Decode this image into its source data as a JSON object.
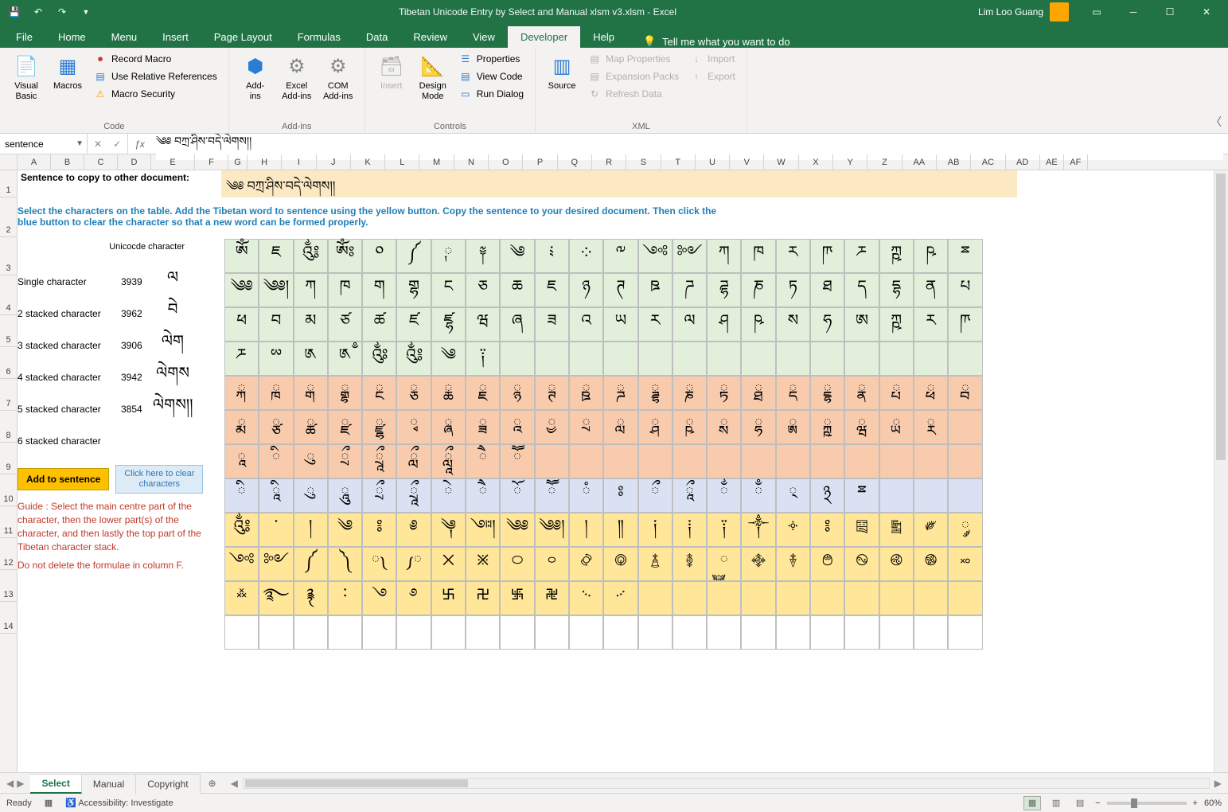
{
  "title": "Tibetan Unicode Entry by Select and Manual xlsm v3.xlsm  -  Excel",
  "user": "Lim Loo Guang",
  "tabs": [
    "File",
    "Home",
    "Menu",
    "Insert",
    "Page Layout",
    "Formulas",
    "Data",
    "Review",
    "View",
    "Developer",
    "Help"
  ],
  "active_tab": "Developer",
  "tell_me": "Tell me what you want to do",
  "ribbon": {
    "code": {
      "visual_basic": "Visual\nBasic",
      "macros": "Macros",
      "record_macro": "Record Macro",
      "use_relative": "Use Relative References",
      "macro_security": "Macro Security",
      "label": "Code"
    },
    "addins": {
      "addins": "Add-\nins",
      "excel_addins": "Excel\nAdd-ins",
      "com_addins": "COM\nAdd-ins",
      "label": "Add-ins"
    },
    "controls": {
      "insert": "Insert",
      "design_mode": "Design\nMode",
      "properties": "Properties",
      "view_code": "View Code",
      "run_dialog": "Run Dialog",
      "label": "Controls"
    },
    "xml": {
      "source": "Source",
      "map_properties": "Map Properties",
      "expansion_packs": "Expansion Packs",
      "refresh_data": "Refresh Data",
      "import": "Import",
      "export": "Export",
      "label": "XML"
    }
  },
  "name_box": "sentence",
  "formula": "༄༅ བཀྲ་ཤིས་བདེ་ལེགས།།",
  "columns": [
    "A",
    "B",
    "C",
    "D",
    "E",
    "F",
    "G",
    "H",
    "I",
    "J",
    "K",
    "L",
    "M",
    "N",
    "O",
    "P",
    "Q",
    "R",
    "S",
    "T",
    "U",
    "V",
    "W",
    "X",
    "Y",
    "Z",
    "AA",
    "AB",
    "AC",
    "AD",
    "AE",
    "AF"
  ],
  "sentence_label": "Sentence to copy to other document:",
  "sentence_value": "༄༅ བཀྲ་ཤིས་བདེ་ལེགས།།",
  "instruction": "Select the characters on the table. Add the Tibetan word to sentence using the yellow button. Copy the sentence to your desired document. Then click the blue button to clear the character so that a new word can be formed properly.",
  "unicode_header": "Unicocde character",
  "left_rows": [
    {
      "label": "Single character",
      "code": "3939",
      "char": "ལ"
    },
    {
      "label": "2 stacked character",
      "code": "3962",
      "char": "བེ"
    },
    {
      "label": "3 stacked character",
      "code": "3906",
      "char": "ལེག"
    },
    {
      "label": "4 stacked character",
      "code": "3942",
      "char": "ལེགས"
    },
    {
      "label": "5 stacked character",
      "code": "3854",
      "char": "ལེགས།།"
    },
    {
      "label": "6 stacked character",
      "code": "",
      "char": ""
    }
  ],
  "btn_add": "Add to sentence",
  "btn_clear": "Click here to clear characters",
  "guide1": "Guide : Select the main centre part of the character, then the lower part(s) of the character, and then lastly the top part of the Tibetan character stack.",
  "guide2": "Do not delete the formulae in column F.",
  "char_rows": [
    {
      "cls": "green",
      "chars": [
        "ༀ",
        "ཇ",
        "༃",
        "ༀཿ",
        "༠",
        "༼",
        "༙",
        "༈",
        "༄",
        "༴",
        "༶",
        "༸",
        "༺",
        "༻",
        "ཀ",
        "ཁ",
        "ཪ",
        "ཫ",
        "ཬ",
        "ཀྵ",
        "ཥ",
        "ྈ"
      ]
    },
    {
      "cls": "green",
      "chars": [
        "༄༅",
        "༄༅།",
        "ཀ",
        "ཁ",
        "ག",
        "གྷ",
        "ང",
        "ཅ",
        "ཆ",
        "ཇ",
        "ཉ",
        "ཊ",
        "ཋ",
        "ཌ",
        "ཌྷ",
        "ཎ",
        "ཏ",
        "ཐ",
        "ད",
        "དྷ",
        "ན",
        "པ"
      ]
    },
    {
      "cls": "green",
      "chars": [
        "ཕ",
        "བ",
        "མ",
        "ཙ",
        "ཚ",
        "ཛ",
        "ཛྷ",
        "ཝ",
        "ཞ",
        "ཟ",
        "འ",
        "ཡ",
        "ར",
        "ལ",
        "ཤ",
        "ཥ",
        "ས",
        "ཧ",
        "ཨ",
        "ཀྵ",
        "ཪ",
        "ཫ"
      ]
    },
    {
      "cls": "green",
      "chars": [
        "ཬ",
        "ྌ",
        "༁",
        "༁ྃ",
        "༂",
        "༃",
        "༄",
        "༑",
        "",
        "",
        "",
        "",
        "",
        "",
        "",
        "",
        "",
        "",
        "",
        "",
        "",
        ""
      ]
    },
    {
      "cls": "orange",
      "chars": [
        "ྐ",
        "ྑ",
        "ྒ",
        "ྒྷ",
        "ྔ",
        "ྕ",
        "ྖ",
        "ྗ",
        "ྙ",
        "ྚ",
        "ྛ",
        "ྜ",
        "ྜྷ",
        "ྞ",
        "ྟ",
        "ྠ",
        "ྡ",
        "ྡྷ",
        "ྣ",
        "ྤ",
        "ྥ",
        "ྦ"
      ]
    },
    {
      "cls": "orange",
      "chars": [
        "ྨ",
        "ྩ",
        "ྪ",
        "ྫ",
        "ྫྷ",
        "ྭ",
        "ྮ",
        "ྯ",
        "ྰ",
        "ྱ",
        "ྲ",
        "ླ",
        "ྴ",
        "ྵ",
        "ྶ",
        "ྷ",
        "ྸ",
        "ྐྵ",
        "ྺ",
        "ྻ",
        "ྼ",
        ""
      ]
    },
    {
      "cls": "orange",
      "chars": [
        "ཱ",
        "ི",
        "ུ",
        "ྲྀ",
        "ཷ",
        "ླྀ",
        "ཹ",
        "ཻ",
        "ཽ",
        "",
        "",
        "",
        "",
        "",
        "",
        "",
        "",
        "",
        "",
        "",
        "",
        ""
      ]
    },
    {
      "cls": "blue",
      "chars": [
        "ི",
        "ཱི",
        "ུ",
        "ཱུ",
        "ྲྀ",
        "ཷ",
        "ེ",
        "ཻ",
        "ོ",
        "ཽ",
        "ཾ",
        "ཿ",
        "ྀ",
        "ཱྀ",
        "ྂ",
        "ྃ",
        "྄",
        "྅",
        "ྈ",
        "",
        "",
        ""
      ]
    },
    {
      "cls": "yellow",
      "chars": [
        "༃",
        "་",
        "།",
        "༄",
        "༔",
        "༅",
        "༆",
        "༇།",
        "༄༅",
        "༄༅།",
        "།",
        "༎",
        "༏",
        "༐",
        "༑",
        "༒",
        "༓",
        "༔",
        "༕",
        "༖",
        "༗",
        "༘"
      ]
    },
    {
      "cls": "yellow",
      "chars": [
        "༺",
        "༻",
        "༼",
        "༽",
        "༾",
        "༿",
        "྾",
        "྿",
        "࿀",
        "࿁",
        "࿂",
        "࿃",
        "࿄",
        "࿅",
        "࿆",
        "࿇",
        "࿈",
        "࿉",
        "࿊",
        "࿋",
        "࿌",
        "࿎"
      ]
    },
    {
      "cls": "yellow",
      "chars": [
        "࿏",
        "࿐",
        "࿑",
        "࿒",
        "࿓",
        "࿔",
        "࿕",
        "࿖",
        "࿗",
        "࿘",
        "࿙",
        "࿚",
        "",
        "",
        "",
        "",
        "",
        "",
        "",
        "",
        "",
        ""
      ]
    },
    {
      "cls": "white",
      "chars": [
        "",
        "",
        "",
        "",
        "",
        "",
        "",
        "",
        "",
        "",
        "",
        "",
        "",
        "",
        "",
        "",
        "",
        "",
        "",
        "",
        "",
        ""
      ]
    }
  ],
  "sheets": [
    "Select",
    "Manual",
    "Copyright"
  ],
  "active_sheet": "Select",
  "status": {
    "ready": "Ready",
    "accessibility": "Accessibility: Investigate",
    "zoom": "60%"
  }
}
